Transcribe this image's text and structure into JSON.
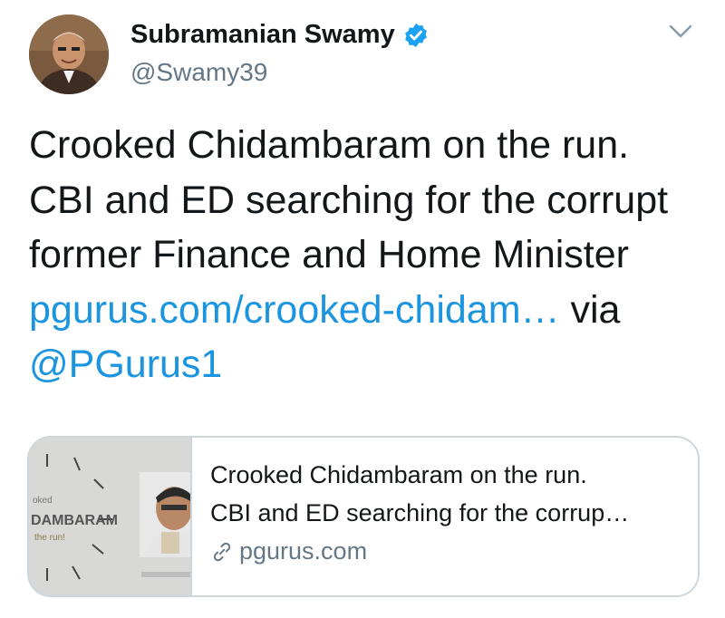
{
  "author": {
    "display_name": "Subramanian Swamy",
    "handle": "@Swamy39",
    "verified": true
  },
  "tweet": {
    "text_before": "Crooked Chidambaram on the run. CBI and ED searching for the corrupt former Finance and Home Minister",
    "link_text": "pgurus.com/crooked-chidam…",
    "via_text": "via",
    "mention": "@PGurus1"
  },
  "card": {
    "title": "Crooked Chidambaram on the run.",
    "description": "CBI and ED searching for the corrup…",
    "domain": "pgurus.com",
    "thumbnail_text": {
      "line1": "oked",
      "line2": "DAMBARAM",
      "line3": "the run!"
    }
  },
  "colors": {
    "link": "#1b95e0",
    "secondary": "#657786",
    "verified": "#1da1f2",
    "border": "#ccd6dd"
  },
  "icons": [
    "verified-badge-icon",
    "chevron-down-icon",
    "link-icon"
  ]
}
